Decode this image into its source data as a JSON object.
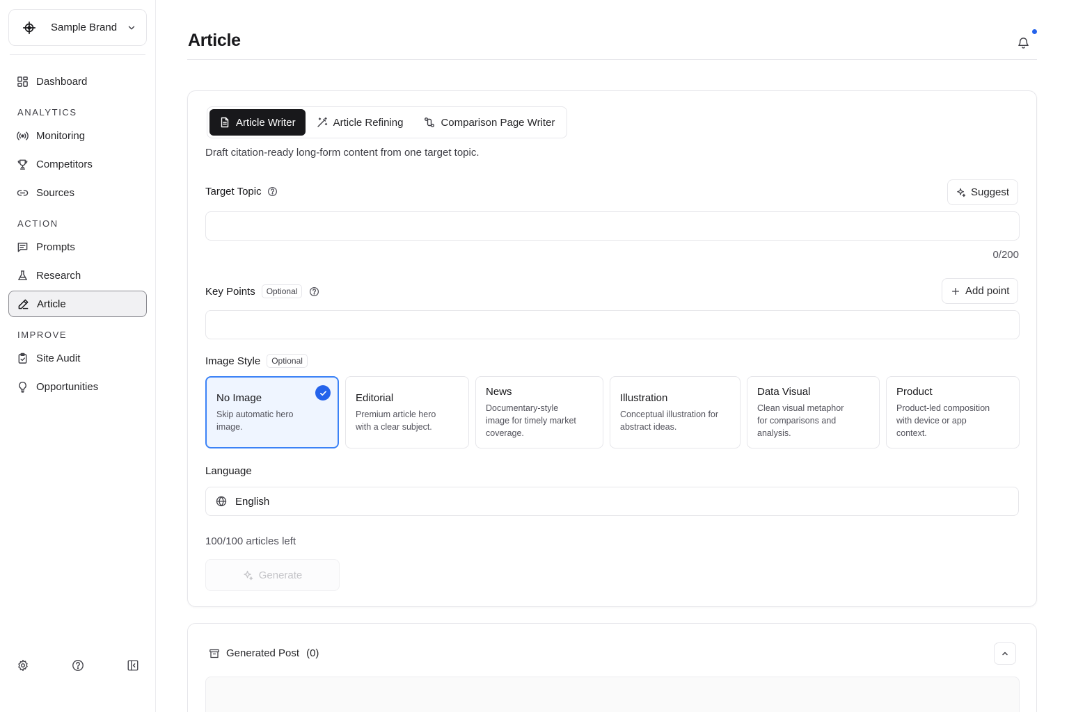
{
  "brand": {
    "name": "Sample Brand"
  },
  "nav": {
    "dashboard": "Dashboard",
    "section_analytics": "ANALYTICS",
    "monitoring": "Monitoring",
    "competitors": "Competitors",
    "sources": "Sources",
    "section_action": "ACTION",
    "prompts": "Prompts",
    "research": "Research",
    "article": "Article",
    "section_improve": "IMPROVE",
    "site_audit": "Site Audit",
    "opportunities": "Opportunities"
  },
  "page": {
    "title": "Article"
  },
  "tabs": [
    {
      "label": "Article Writer",
      "icon": "document-icon"
    },
    {
      "label": "Article Refining",
      "icon": "magic-wand-icon"
    },
    {
      "label": "Comparison Page Writer",
      "icon": "git-compare-icon"
    }
  ],
  "description": "Draft citation-ready long-form content from one target topic.",
  "target_topic": {
    "label": "Target Topic",
    "suggest_label": "Suggest",
    "value": "",
    "counter": "0/200"
  },
  "key_points": {
    "label": "Key Points",
    "badge": "Optional",
    "add_label": "Add point",
    "value": ""
  },
  "image_style": {
    "label": "Image Style",
    "badge": "Optional",
    "options": [
      {
        "title": "No Image",
        "desc": "Skip automatic hero image.",
        "selected": true
      },
      {
        "title": "Editorial",
        "desc": "Premium article hero with a clear subject.",
        "selected": false
      },
      {
        "title": "News",
        "desc": "Documentary-style image for timely market coverage.",
        "selected": false
      },
      {
        "title": "Illustration",
        "desc": "Conceptual illustration for abstract ideas.",
        "selected": false
      },
      {
        "title": "Data Visual",
        "desc": "Clean visual metaphor for comparisons and analysis.",
        "selected": false
      },
      {
        "title": "Product",
        "desc": "Product-led composition with device or app context.",
        "selected": false
      }
    ]
  },
  "language": {
    "label": "Language",
    "value": "English"
  },
  "quota": "100/100 articles left",
  "generate_label": "Generate",
  "generated_post": {
    "label": "Generated Post",
    "count": "(0)"
  },
  "colors": {
    "accent": "#2563eb",
    "selected_bg": "#eff5ff",
    "dark": "#18181b"
  }
}
